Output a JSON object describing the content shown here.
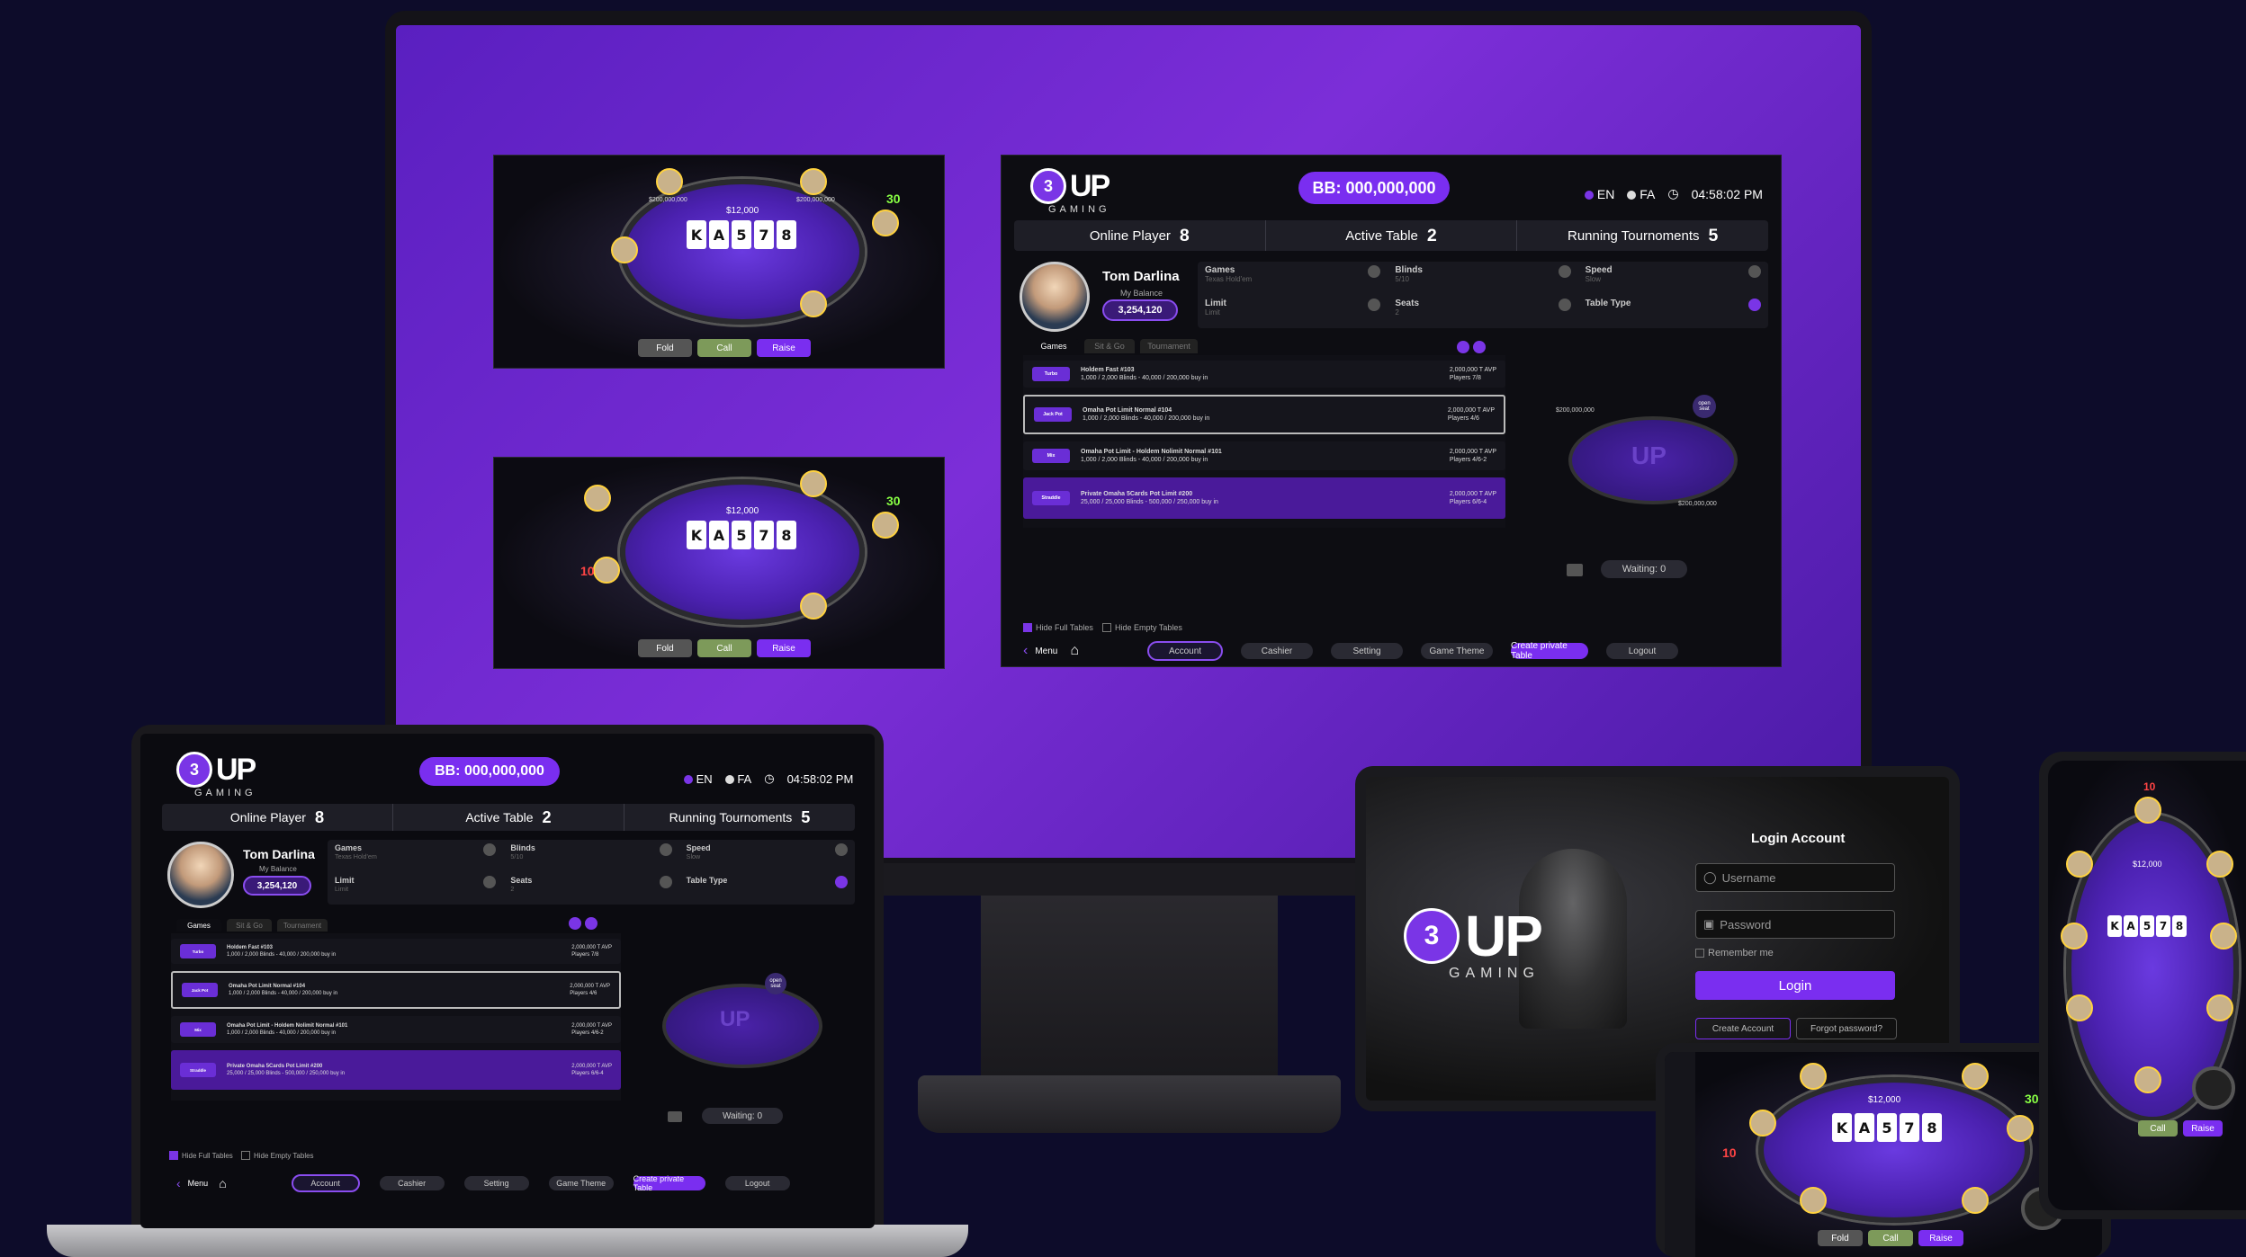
{
  "brand": {
    "logo_num": "3",
    "logo_text": "UP",
    "logo_sub": "GAMING"
  },
  "lobby": {
    "bb_label": "BB: 000,000,000",
    "lang_en": "EN",
    "lang_fa": "FA",
    "time": "04:58:02 PM",
    "stats": [
      {
        "label": "Online Player",
        "value": "8"
      },
      {
        "label": "Active Table",
        "value": "2"
      },
      {
        "label": "Running Tournoments",
        "value": "5"
      }
    ],
    "user": {
      "name": "Tom Darlina",
      "balance_label": "My Balance",
      "balance": "3,254,120"
    },
    "filters": [
      {
        "label": "Games",
        "sub": "Texas Hold'em"
      },
      {
        "label": "Blinds",
        "sub": "5/10"
      },
      {
        "label": "Speed",
        "sub": "Slow"
      },
      {
        "label": "Limit",
        "sub": "Limit"
      },
      {
        "label": "Seats",
        "sub": "2"
      },
      {
        "label": "Table Type",
        "sub": ""
      }
    ],
    "tabs": [
      "Games",
      "Sit & Go",
      "Tournament"
    ],
    "tables": [
      {
        "tag": "Turbo",
        "name": "Holdem Fast #103",
        "details": "1,000 / 2,000  Blinds - 40,000 / 200,000 buy in",
        "avp": "2,000,000 T  AVP",
        "players": "Players 7/8"
      },
      {
        "tag": "Jack Pot",
        "name": "Omaha Pot Limit Normal #104",
        "details": "1,000 / 2,000  Blinds - 40,000 / 200,000 buy in",
        "avp": "2,000,000 T  AVP",
        "players": "Players 4/6"
      },
      {
        "tag": "Mix",
        "name": "Omaha Pot Limit - Holdem Nolimit Normal #101",
        "details": "1,000 / 2,000  Blinds - 40,000 / 200,000 buy in",
        "avp": "2,000,000 T  AVP",
        "players": "Players 4/6-2"
      },
      {
        "tag": "Straddle",
        "name": "Private Omaha 5Cards Pot Limit #200",
        "details": "25,000 / 25,000  Blinds - 500,000 / 250,000 buy in",
        "avp": "2,000,000 T  AVP",
        "players": "Players 6/6-4"
      }
    ],
    "mini_seats": [
      "Next",
      "$200,000,000",
      "open seat"
    ],
    "waiting": "Waiting: 0",
    "hide_full": "Hide Full Tables",
    "hide_empty": "Hide Empty Tables",
    "menu": "Menu",
    "buttons": [
      "Account",
      "Cashier",
      "Setting",
      "Game Theme",
      "Create private Table",
      "Logout"
    ]
  },
  "poker": {
    "pot": "$12,000",
    "cards": [
      "K",
      "A",
      "5",
      "7",
      "8"
    ],
    "fold": "Fold",
    "call": "Call",
    "raise": "Raise",
    "stack": "$200,000,000",
    "timer1": "30",
    "timer2": "10"
  },
  "login": {
    "title": "Login Account",
    "username_ph": "Username",
    "password_ph": "Password",
    "remember": "Remember me",
    "login_btn": "Login",
    "create": "Create Account",
    "forgot": "Forgot password?"
  }
}
